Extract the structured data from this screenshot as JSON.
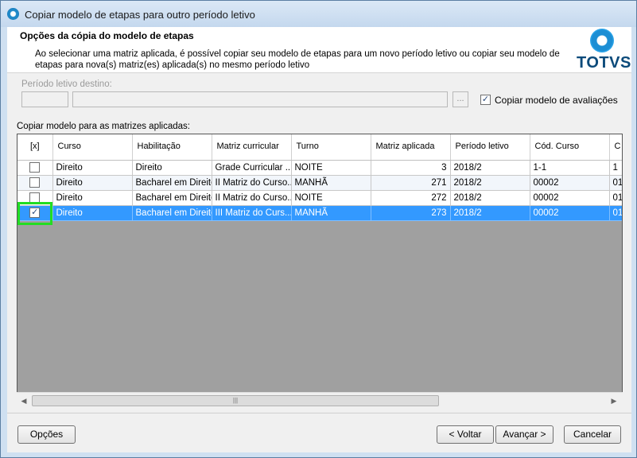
{
  "window": {
    "title": "Copiar modelo de etapas para outro período letivo"
  },
  "header": {
    "title": "Opções da cópia do modelo de etapas",
    "description": "Ao selecionar uma matriz aplicada, é possível copiar seu modelo de etapas para um novo período letivo ou copiar seu modelo de etapas para nova(s) matriz(es) aplicada(s) no mesmo período letivo",
    "logo_text": "TOTVS"
  },
  "form": {
    "periodo_label": "Período letivo destino:",
    "periodo_code_value": "",
    "periodo_desc_value": "",
    "browse_label": "...",
    "copiar_avaliacoes_label": "Copiar modelo de avaliações",
    "copiar_avaliacoes_checked": true
  },
  "grid": {
    "label": "Copiar modelo para as matrizes aplicadas:",
    "columns": [
      "[x]",
      "Curso",
      "Habilitação",
      "Matriz curricular",
      "Turno",
      "Matriz aplicada",
      "Período letivo",
      "Cód. Curso",
      "C H"
    ],
    "rows": [
      {
        "checked": false,
        "curso": "Direito",
        "habilitacao": "Direito",
        "matriz": "Grade Curricular ...",
        "turno": "NOITE",
        "aplicada": "3",
        "periodo": "2018/2",
        "cod": "1-1",
        "extra": "1"
      },
      {
        "checked": false,
        "curso": "Direito",
        "habilitacao": "Bacharel em Direito",
        "matriz": "II Matriz do Curso...",
        "turno": "MANHÃ",
        "aplicada": "271",
        "periodo": "2018/2",
        "cod": "00002",
        "extra": "01"
      },
      {
        "checked": false,
        "curso": "Direito",
        "habilitacao": "Bacharel em Direito",
        "matriz": "II Matriz do Curso...",
        "turno": "NOITE",
        "aplicada": "272",
        "periodo": "2018/2",
        "cod": "00002",
        "extra": "01"
      },
      {
        "checked": true,
        "curso": "Direito",
        "habilitacao": "Bacharel em Direito",
        "matriz": "III Matriz do Curs...",
        "turno": "MANHÃ",
        "aplicada": "273",
        "periodo": "2018/2",
        "cod": "00002",
        "extra": "01"
      }
    ],
    "selected_row": 3
  },
  "buttons": {
    "opcoes": "Opções",
    "voltar": "< Voltar",
    "avancar": "Avançar >",
    "cancelar": "Cancelar"
  },
  "icons": {
    "check": "✓",
    "scroll_left": "◀",
    "scroll_right": "▶",
    "scroll_grip": "|||"
  }
}
